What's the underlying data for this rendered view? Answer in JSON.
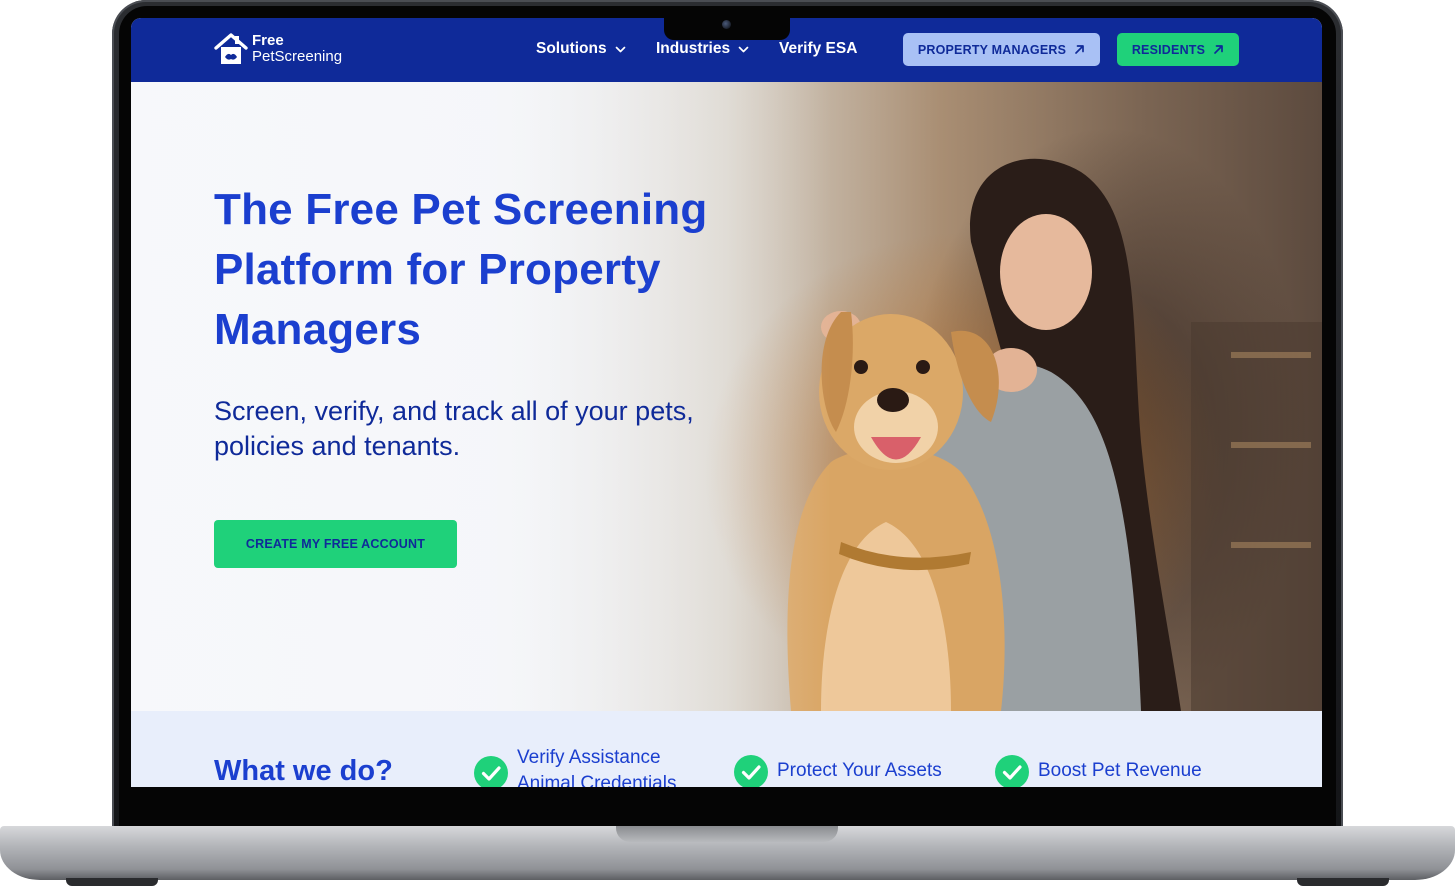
{
  "brand": {
    "line1": "Free",
    "line2": "PetScreening"
  },
  "nav": {
    "items": [
      {
        "label": "Solutions",
        "has_dropdown": true
      },
      {
        "label": "Industries",
        "has_dropdown": true
      },
      {
        "label": "Verify ESA",
        "has_dropdown": false
      }
    ],
    "property_managers_label": "PROPERTY MANAGERS",
    "residents_label": "RESIDENTS"
  },
  "hero": {
    "title": "The Free Pet Screening Platform for Property Managers",
    "subtitle": "Screen, verify, and track all of your pets, policies and tenants.",
    "cta_label": "CREATE MY FREE ACCOUNT"
  },
  "what_we_do": {
    "title": "What we do?",
    "features": [
      {
        "label": "Verify Assistance Animal Credentials"
      },
      {
        "label": "Protect Your Assets"
      },
      {
        "label": "Boost Pet Revenue"
      }
    ]
  },
  "colors": {
    "nav_bg": "#0f2a99",
    "brand_blue": "#1b3fcf",
    "accent_green": "#1fd17a",
    "pm_button_bg": "#a9c1f5",
    "strip_bg": "#e8eefb"
  }
}
